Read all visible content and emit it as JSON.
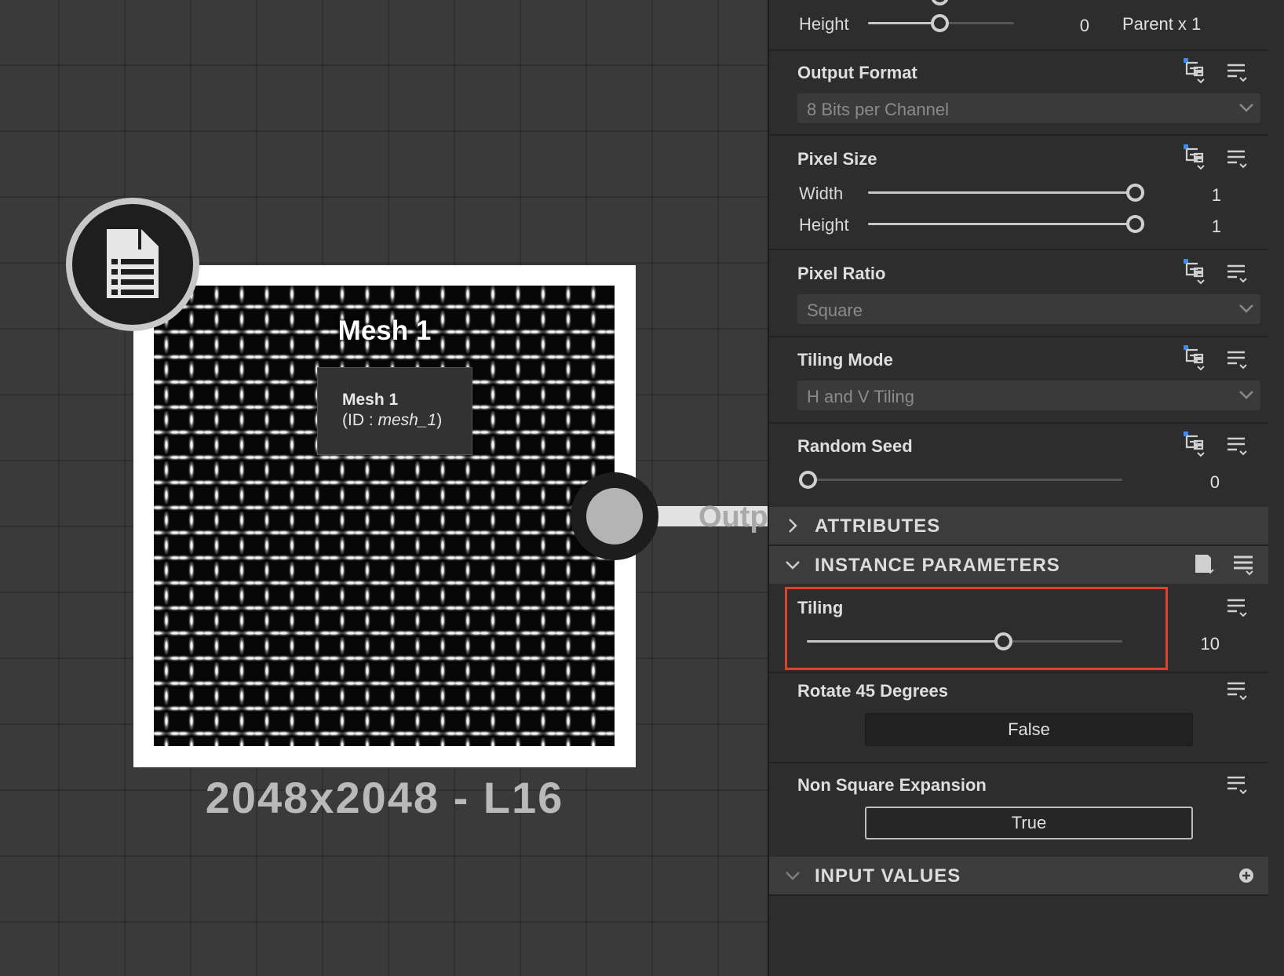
{
  "graph": {
    "node_title": "Mesh 1",
    "tooltip": {
      "name": "Mesh 1",
      "id_prefix": "(ID : ",
      "id_value": "mesh_1",
      "id_suffix": ")"
    },
    "output_label": "Outp",
    "resolution": "2048x2048 - L16",
    "node_icon": "document-list-icon"
  },
  "panel": {
    "top_height": {
      "label": "Height",
      "value": "0",
      "suffix": "Parent x 1"
    },
    "output_format": {
      "title": "Output Format",
      "selected": "8 Bits per Channel"
    },
    "pixel_size": {
      "title": "Pixel Size",
      "width_label": "Width",
      "width_value": "1",
      "height_label": "Height",
      "height_value": "1"
    },
    "pixel_ratio": {
      "title": "Pixel Ratio",
      "selected": "Square"
    },
    "tiling_mode": {
      "title": "Tiling Mode",
      "selected": "H and V Tiling"
    },
    "random_seed": {
      "title": "Random Seed",
      "value": "0"
    },
    "attributes": {
      "title": "ATTRIBUTES"
    },
    "instance_parameters": {
      "title": "INSTANCE PARAMETERS",
      "tiling": {
        "label": "Tiling",
        "value": "10"
      },
      "rotate": {
        "label": "Rotate 45 Degrees",
        "button": "False"
      },
      "non_square": {
        "label": "Non Square Expansion",
        "button": "True"
      }
    },
    "input_values": {
      "title": "INPUT VALUES"
    }
  },
  "colors": {
    "highlight": "#e0412a",
    "accent_blue": "#3d8bf0"
  }
}
